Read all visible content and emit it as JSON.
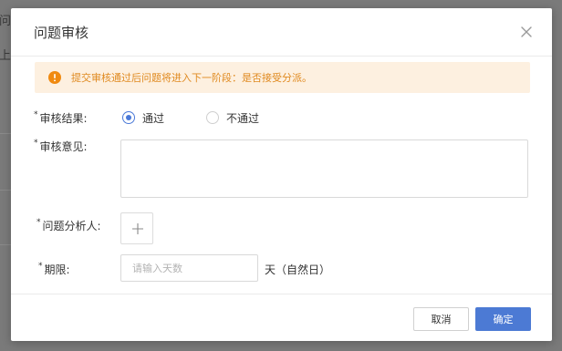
{
  "background": {
    "text_1": "问",
    "text_2": "上"
  },
  "dialog": {
    "title": "问题审核",
    "alert": "提交审核通过后问题将进入下一阶段：是否接受分派。",
    "form": {
      "required_mark": "*",
      "result_label": "审核结果:",
      "result_options": [
        "通过",
        "不通过"
      ],
      "result_selected": "通过",
      "opinion_label": "审核意见:",
      "opinion_value": "",
      "analyst_label": "问题分析人:",
      "deadline_label": "期限:",
      "deadline_placeholder": "请输入天数",
      "deadline_unit": "天（自然日）"
    },
    "buttons": {
      "cancel": "取消",
      "confirm": "确定"
    }
  },
  "colors": {
    "accent": "#4c7ad4",
    "alert_bg": "#fdf0e0",
    "alert_text": "#e08a20"
  },
  "icons": {
    "close": "close-icon",
    "warning": "warning-icon",
    "add": "plus-icon"
  }
}
